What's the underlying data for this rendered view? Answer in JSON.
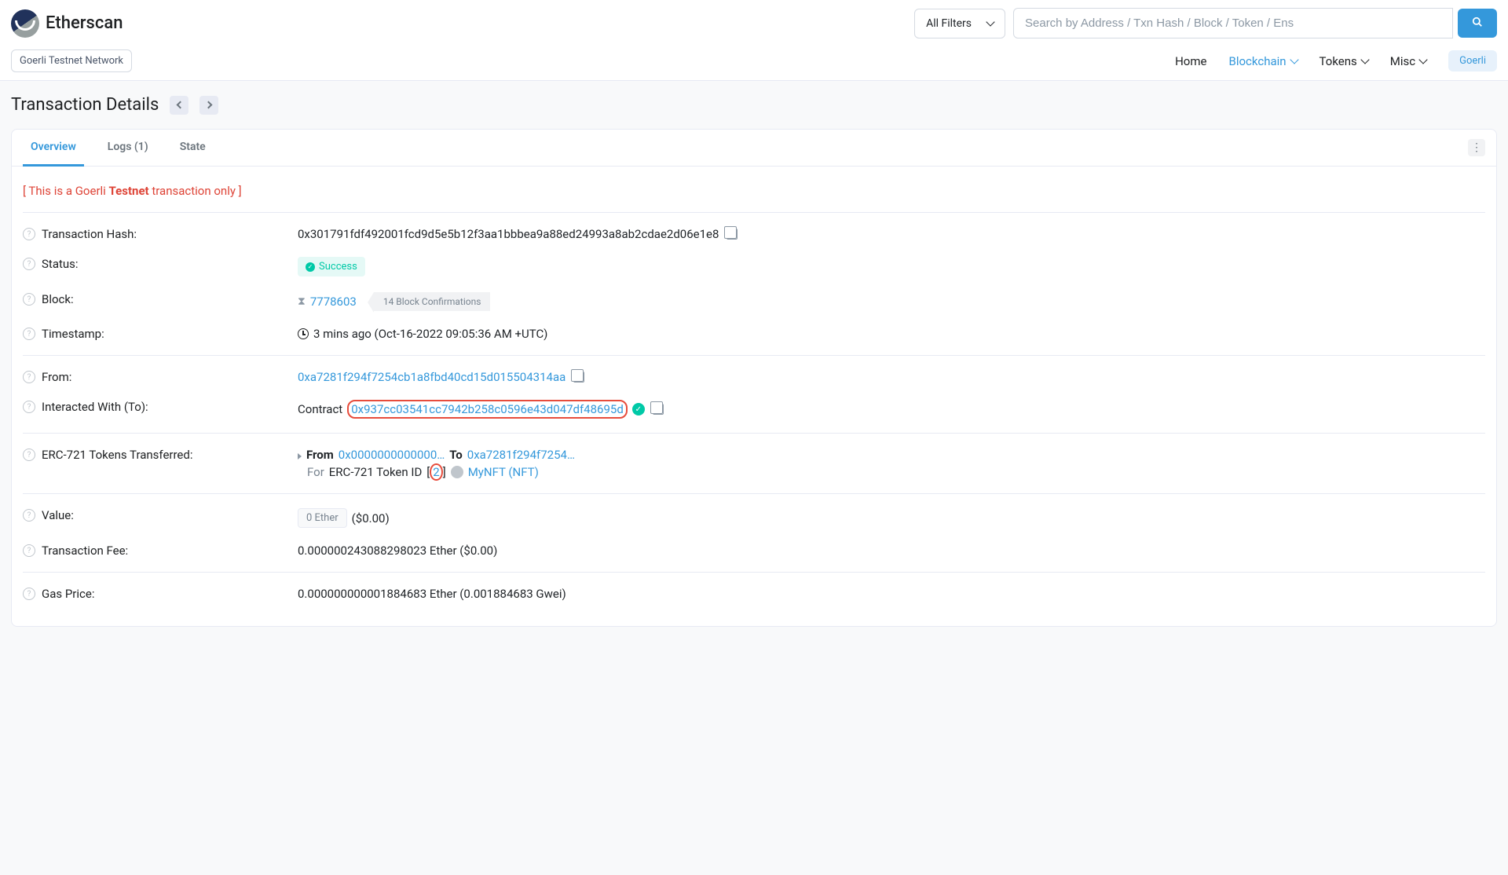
{
  "brand": "Etherscan",
  "network_label": "Goerli Testnet Network",
  "search": {
    "filter": "All Filters",
    "placeholder": "Search by Address / Txn Hash / Block / Token / Ens"
  },
  "nav": {
    "home": "Home",
    "blockchain": "Blockchain",
    "tokens": "Tokens",
    "misc": "Misc",
    "goerli": "Goerli"
  },
  "page_title": "Transaction Details",
  "tabs": {
    "overview": "Overview",
    "logs": "Logs (1)",
    "state": "State"
  },
  "notice": {
    "prefix": "[ This is a Goerli ",
    "bold": "Testnet",
    "suffix": " transaction only ]"
  },
  "labels": {
    "txhash": "Transaction Hash:",
    "status": "Status:",
    "block": "Block:",
    "timestamp": "Timestamp:",
    "from": "From:",
    "to": "Interacted With (To):",
    "erc721": "ERC-721 Tokens Transferred:",
    "value": "Value:",
    "fee": "Transaction Fee:",
    "gas": "Gas Price:"
  },
  "txhash": "0x301791fdf492001fcd9d5e5b12f3aa1bbbea9a88ed24993a8ab2cdae2d06e1e8",
  "status": "Success",
  "block": {
    "number": "7778603",
    "confirmations": "14 Block Confirmations"
  },
  "timestamp": "3 mins ago (Oct-16-2022 09:05:36 AM +UTC)",
  "from": "0xa7281f294f7254cb1a8fbd40cd15d015504314aa",
  "to": {
    "prefix": "Contract",
    "address": "0x937cc03541cc7942b258c0596e43d047df48695d"
  },
  "erc721": {
    "from_label": "From",
    "from_addr": "0x0000000000000…",
    "to_label": "To",
    "to_addr": "0xa7281f294f7254…",
    "for_label": "For",
    "token_label": "ERC-721 Token ID",
    "token_id": "2",
    "token_name": "MyNFT (NFT)"
  },
  "value": {
    "ether": "0 Ether",
    "usd": "($0.00)"
  },
  "fee": "0.000000243088298023 Ether ($0.00)",
  "gas": "0.000000000001884683 Ether (0.001884683 Gwei)"
}
